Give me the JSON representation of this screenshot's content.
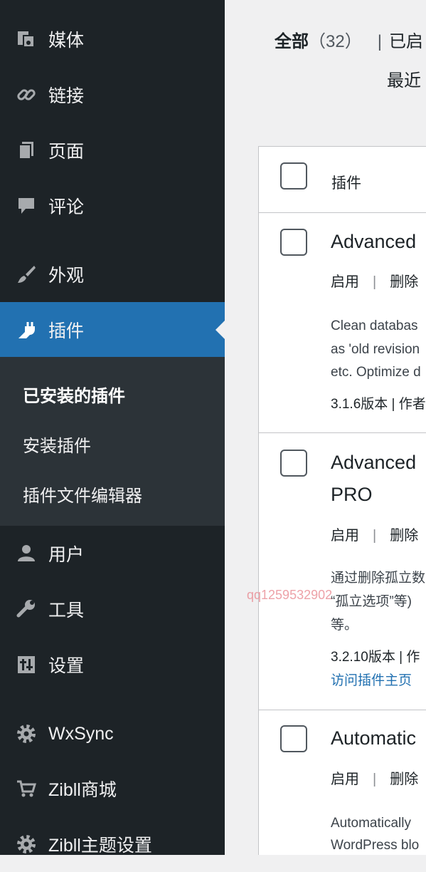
{
  "sidebar": {
    "items": [
      {
        "label": "媒体",
        "icon": "media-icon"
      },
      {
        "label": "链接",
        "icon": "link-icon"
      },
      {
        "label": "页面",
        "icon": "page-icon"
      },
      {
        "label": "评论",
        "icon": "comment-icon"
      },
      {
        "label": "外观",
        "icon": "brush-icon"
      },
      {
        "label": "插件",
        "icon": "plugin-icon"
      },
      {
        "label": "用户",
        "icon": "user-icon"
      },
      {
        "label": "工具",
        "icon": "wrench-icon"
      },
      {
        "label": "设置",
        "icon": "settings-icon"
      },
      {
        "label": "WxSync",
        "icon": "gear-icon"
      },
      {
        "label": "Zibll商城",
        "icon": "cart-icon"
      },
      {
        "label": "Zibll主题设置",
        "icon": "gear-icon"
      }
    ],
    "submenu": [
      "已安装的插件",
      "安装插件",
      "插件文件编辑器"
    ]
  },
  "filters": {
    "all_label": "全部",
    "all_count": "（32）",
    "separator": "|",
    "enabled_label": "已启"
  },
  "recent_label": "最近",
  "table": {
    "column_header": "插件",
    "plugins": [
      {
        "name": "Advanced",
        "actions": [
          "启用",
          "删除"
        ],
        "description": [
          "Clean databas",
          "as 'old revision",
          "etc. Optimize d"
        ],
        "meta": "3.1.6版本 | 作者"
      },
      {
        "name_lines": [
          "Advanced",
          "PRO"
        ],
        "actions": [
          "启用",
          "删除"
        ],
        "description": [
          "通过删除孤立数",
          "“孤立选项”等)",
          "等。"
        ],
        "meta": "3.2.10版本 | 作",
        "meta2": "访问插件主页"
      },
      {
        "name": "Automatic",
        "actions": [
          "启用",
          "删除"
        ],
        "description": [
          "Automatically",
          "WordPress blo"
        ]
      }
    ]
  },
  "watermark": "qq1259532902",
  "colors": {
    "sidebar_bg": "#1d2327",
    "active_bg": "#2271b1",
    "submenu_bg": "#2c3338",
    "page_bg": "#f0f0f1"
  }
}
